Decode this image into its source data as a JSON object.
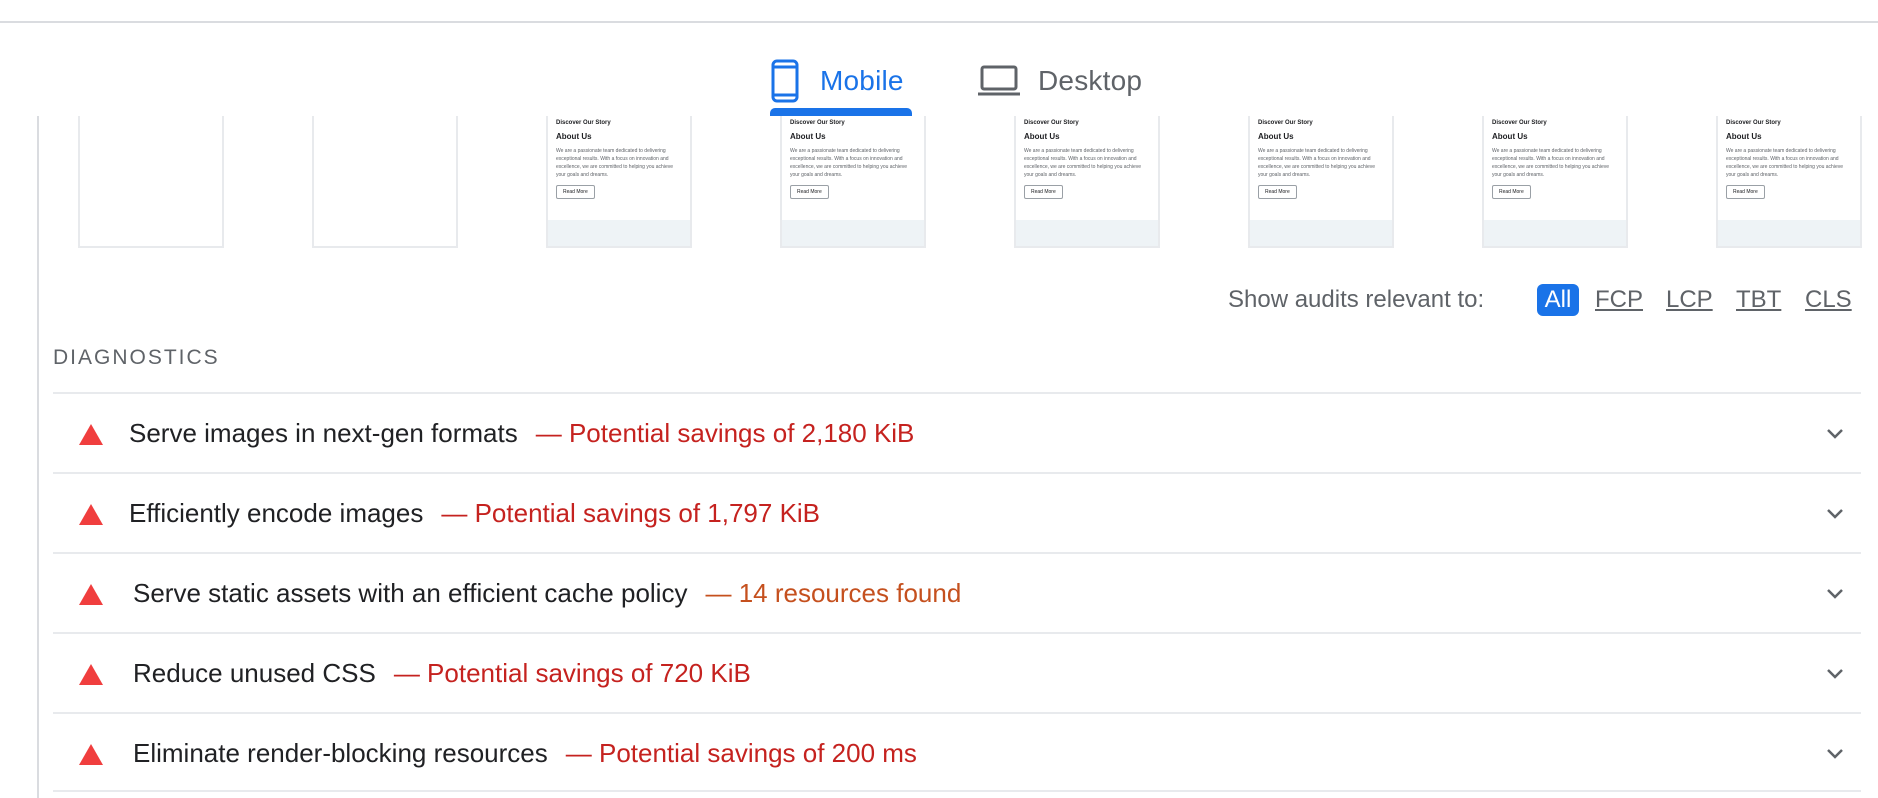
{
  "device_tabs": {
    "mobile": {
      "label": "Mobile",
      "icon": "smartphone-icon",
      "active": true
    },
    "desktop": {
      "label": "Desktop",
      "icon": "laptop-icon",
      "active": false
    }
  },
  "filmstrip": {
    "frames": [
      {
        "blank": true
      },
      {
        "blank": true
      },
      {
        "blank": false,
        "subtitle": "Discover Our Story",
        "title": "About Us",
        "body": "We are a passionate team dedicated to delivering exceptional results. With a focus on innovation and excellence, we are committed to helping you achieve your goals and dreams.",
        "button": "Read More"
      },
      {
        "blank": false,
        "subtitle": "Discover Our Story",
        "title": "About Us",
        "body": "We are a passionate team dedicated to delivering exceptional results. With a focus on innovation and excellence, we are committed to helping you achieve your goals and dreams.",
        "button": "Read More"
      },
      {
        "blank": false,
        "subtitle": "Discover Our Story",
        "title": "About Us",
        "body": "We are a passionate team dedicated to delivering exceptional results. With a focus on innovation and excellence, we are committed to helping you achieve your goals and dreams.",
        "button": "Read More"
      },
      {
        "blank": false,
        "subtitle": "Discover Our Story",
        "title": "About Us",
        "body": "We are a passionate team dedicated to delivering exceptional results. With a focus on innovation and excellence, we are committed to helping you achieve your goals and dreams.",
        "button": "Read More"
      },
      {
        "blank": false,
        "subtitle": "Discover Our Story",
        "title": "About Us",
        "body": "We are a passionate team dedicated to delivering exceptional results. With a focus on innovation and excellence, we are committed to helping you achieve your goals and dreams.",
        "button": "Read More"
      },
      {
        "blank": false,
        "subtitle": "Discover Our Story",
        "title": "About Us",
        "body": "We are a passionate team dedicated to delivering exceptional results. With a focus on innovation and excellence, we are committed to helping you achieve your goals and dreams.",
        "button": "Read More"
      }
    ]
  },
  "filter": {
    "label": "Show audits relevant to:",
    "options": [
      "All",
      "FCP",
      "LCP",
      "TBT",
      "CLS"
    ],
    "selected": "All"
  },
  "diagnostics": {
    "heading": "DIAGNOSTICS",
    "audits": [
      {
        "title": "Serve images in next-gen formats",
        "detail": "— Potential savings of 2,180 KiB",
        "status_icon": "fail-triangle-icon"
      },
      {
        "title": "Efficiently encode images",
        "detail": "— Potential savings of 1,797 KiB",
        "status_icon": "fail-triangle-icon"
      },
      {
        "title": "Serve static assets with an efficient cache policy",
        "detail": "— 14 resources found",
        "status_icon": "fail-triangle-icon"
      },
      {
        "title": "Reduce unused CSS",
        "detail": "— Potential savings of 720 KiB",
        "status_icon": "fail-triangle-icon"
      },
      {
        "title": "Eliminate render-blocking resources",
        "detail": "— Potential savings of 200 ms",
        "status_icon": "fail-triangle-icon"
      }
    ]
  },
  "colors": {
    "accent": "#1a73e8",
    "fail": "#f03e3e",
    "detail_red": "#c5221f",
    "detail_orange": "#c5501e"
  }
}
